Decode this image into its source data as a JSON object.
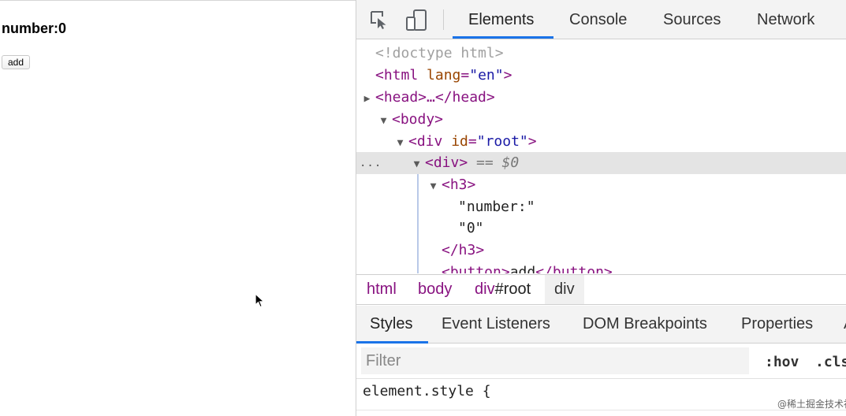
{
  "page": {
    "heading": "number:0",
    "add_button": "add"
  },
  "devtools": {
    "tabs": [
      "Elements",
      "Console",
      "Sources",
      "Network"
    ],
    "active_tab": "Elements",
    "dom": {
      "doctype": "<!doctype html>",
      "html_open_tag": "<html",
      "html_lang_attr": "lang",
      "html_lang_val": "\"en\"",
      "html_close_bracket": ">",
      "head": "<head>…</head>",
      "body": "<body>",
      "root_div_tag": "<div",
      "root_div_attr": "id",
      "root_div_val": "\"root\"",
      "root_div_close": ">",
      "selected_div": "<div>",
      "selected_marker": "== $0",
      "selected_ellipsis": "...",
      "h3_open": "<h3>",
      "text1": "\"number:\"",
      "text2": "\"0\"",
      "h3_close": "</h3>",
      "button_open": "<button>",
      "button_text": "add",
      "button_close": "</button>"
    },
    "breadcrumbs": {
      "html": "html",
      "body": "body",
      "root_tag": "div",
      "root_id": "#root",
      "div": "div"
    },
    "subtabs": [
      "Styles",
      "Event Listeners",
      "DOM Breakpoints",
      "Properties",
      "A"
    ],
    "active_subtab": "Styles",
    "filter_placeholder": "Filter",
    "hov": ":hov",
    "cls": ".cls",
    "element_style": "element.style {",
    "watermark": "@稀土掘金技术社区"
  },
  "colors": {
    "accent": "#1a73e8",
    "tag": "#881280",
    "attr": "#994500",
    "value": "#1a1aa6"
  }
}
